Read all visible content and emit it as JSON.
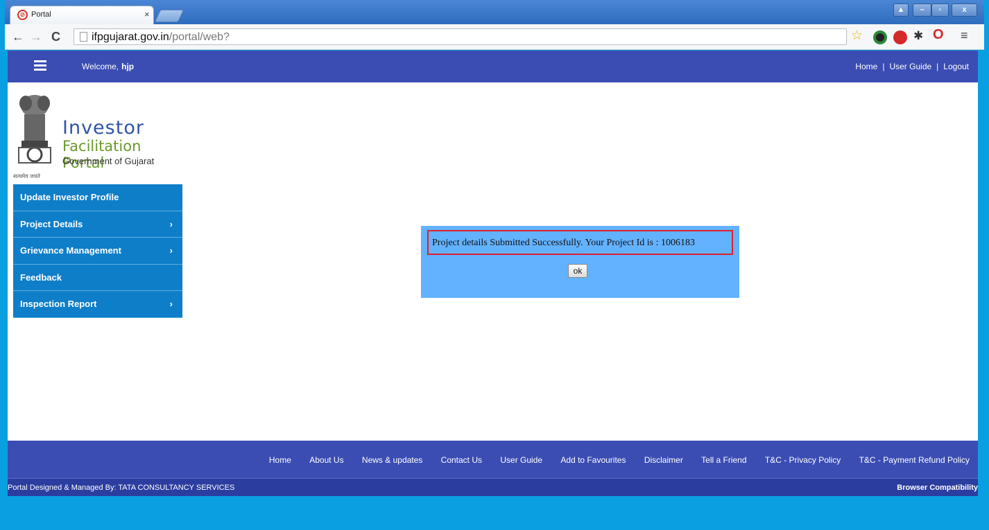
{
  "browser": {
    "tab_title": "Portal",
    "tab_close": "×",
    "url_host": "ifpgujarat.gov.in",
    "url_path": "/portal/web?",
    "window_controls": [
      "▲",
      "–",
      "▫",
      "x"
    ]
  },
  "header": {
    "welcome_label": "Welcome,",
    "username": "hjp",
    "links": [
      "Home",
      "User Guide",
      "Logout"
    ],
    "separator": "|"
  },
  "logo": {
    "line1": "Investor",
    "line2": "Facilitation Portal",
    "line3": "Government of Gujarat",
    "motto": "सत्यमेव जयते"
  },
  "sidebar": {
    "items": [
      {
        "label": "Update Investor Profile",
        "chevron": ""
      },
      {
        "label": "Project Details",
        "chevron": "›"
      },
      {
        "label": "Grievance Management",
        "chevron": "›"
      },
      {
        "label": "Feedback",
        "chevron": ""
      },
      {
        "label": "Inspection Report",
        "chevron": "›"
      }
    ]
  },
  "dialog": {
    "message": "Project details Submitted Successfully. Your Project Id is : 1006183",
    "ok_label": "ok"
  },
  "footer": {
    "links": [
      "Home",
      "About Us",
      "News & updates",
      "Contact Us",
      "User Guide",
      "Add to Favourites",
      "Disclaimer",
      "Tell a Friend",
      "T&C - Privacy Policy",
      "T&C - Payment Refund Policy"
    ],
    "credit": "Portal Designed & Managed By: TATA CONSULTANCY SERVICES",
    "compat": "Browser Compatibility"
  },
  "colors": {
    "header_bg": "#3b4db3",
    "menu_bg": "#0f7ec8",
    "dialog_bg": "#63b2ff",
    "highlight_border": "#e0202a",
    "outer_bg": "#0a9fe0"
  }
}
